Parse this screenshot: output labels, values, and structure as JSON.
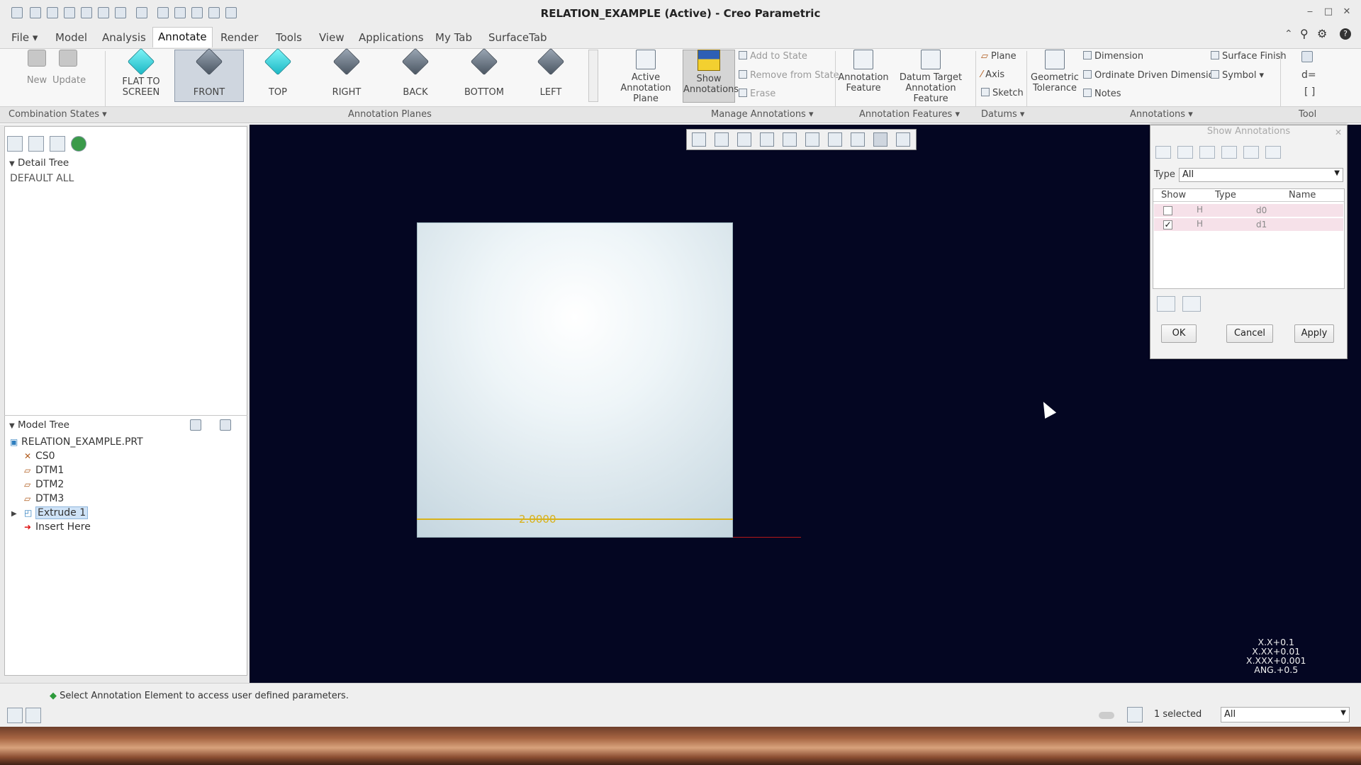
{
  "window": {
    "title": "RELATION_EXAMPLE (Active) - Creo Parametric",
    "min": "‒",
    "max": "□",
    "close": "✕"
  },
  "menubar": {
    "items": [
      "File ▾",
      "Model",
      "Analysis",
      "Annotate",
      "Render",
      "Tools",
      "View",
      "Applications",
      "My Tab",
      "SurfaceTab"
    ],
    "active": "Annotate"
  },
  "ribbon": {
    "combination": {
      "new": "New",
      "update": "Update"
    },
    "planes": [
      {
        "label1": "FLAT TO",
        "label2": "SCREEN",
        "icon": "flat-to-screen-icon"
      },
      {
        "label1": "",
        "label2": "FRONT",
        "icon": "front-view-icon"
      },
      {
        "label1": "",
        "label2": "TOP",
        "icon": "top-view-icon"
      },
      {
        "label1": "",
        "label2": "RIGHT",
        "icon": "right-view-icon"
      },
      {
        "label1": "",
        "label2": "BACK",
        "icon": "back-view-icon"
      },
      {
        "label1": "",
        "label2": "BOTTOM",
        "icon": "bottom-view-icon"
      },
      {
        "label1": "",
        "label2": "LEFT",
        "icon": "left-view-icon"
      }
    ],
    "active_plane": {
      "line1": "Active",
      "line2": "Annotation Plane"
    },
    "show_annotations": {
      "line1": "Show",
      "line2": "Annotations"
    },
    "manage": [
      "Add to State",
      "Remove from State",
      "Erase"
    ],
    "ann_feature": {
      "line1": "Annotation",
      "line2": "Feature"
    },
    "datum_target": {
      "line1": "Datum Target",
      "line2": "Annotation Feature"
    },
    "datums": [
      "Plane",
      "Axis",
      "Sketch"
    ],
    "geom_tol": {
      "line1": "Geometric",
      "line2": "Tolerance"
    },
    "annotations": [
      "Dimension",
      "Ordinate Driven Dimension",
      "Notes"
    ],
    "annotations_right": [
      "Surface Finish",
      "Symbol ▾"
    ],
    "groups": [
      "Combination States ▾",
      "Annotation Planes",
      "Manage Annotations ▾",
      "Annotation Features ▾",
      "Datums ▾",
      "Annotations ▾",
      "Tool"
    ]
  },
  "detail_tree": {
    "header": "Detail Tree",
    "items": [
      "DEFAULT ALL"
    ]
  },
  "model_tree": {
    "header": "Model Tree",
    "items": [
      {
        "icon": "part-icon",
        "label": "RELATION_EXAMPLE.PRT"
      },
      {
        "icon": "csys-icon",
        "label": "CS0"
      },
      {
        "icon": "datum-plane-icon",
        "label": "DTM1"
      },
      {
        "icon": "datum-plane-icon",
        "label": "DTM2"
      },
      {
        "icon": "datum-plane-icon",
        "label": "DTM3"
      },
      {
        "icon": "extrude-icon",
        "label": "Extrude 1"
      },
      {
        "icon": "insert-here-icon",
        "label": "Insert Here"
      }
    ]
  },
  "viewport": {
    "dimension": "2.0000",
    "tolerances": [
      "X.X+0.1",
      "X.XX+0.01",
      "X.XXX+0.001",
      "ANG.+0.5"
    ]
  },
  "dialog": {
    "title": "Show Annotations",
    "type_label": "Type",
    "type_value": "All",
    "columns": [
      "Show",
      "Type",
      "Name"
    ],
    "rows": [
      {
        "checked": false,
        "type": "H",
        "name": "d0"
      },
      {
        "checked": true,
        "type": "H",
        "name": "d1"
      }
    ],
    "ok": "OK",
    "cancel": "Cancel",
    "apply": "Apply"
  },
  "status": {
    "message": "Select Annotation Element to access user defined parameters.",
    "selected": "1 selected",
    "filter": "All"
  },
  "colors": {
    "viewport_bg": "#040622",
    "dimension": "#d8b21a",
    "accent_cyan": "#22c8d4"
  }
}
